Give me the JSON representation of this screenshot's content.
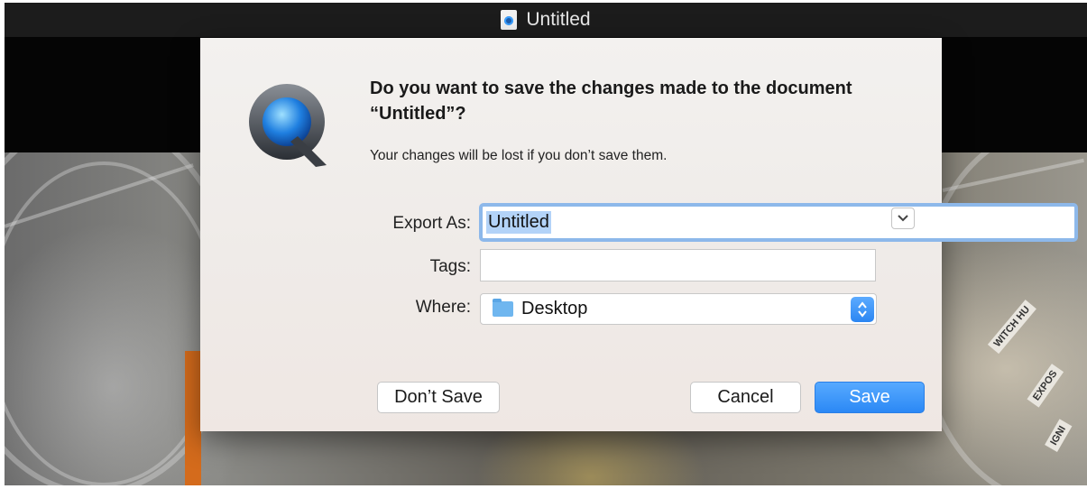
{
  "window": {
    "title": "Untitled",
    "doc_icon": "quicktime-document-icon"
  },
  "background": {
    "tape_labels": [
      "WITCH HU",
      "EXPOS",
      "IGNI"
    ]
  },
  "dialog": {
    "app_icon": "quicktime-q-icon",
    "heading": "Do you want to save the changes made to the document “Untitled”?",
    "message": "Your changes will be lost if you don’t save them.",
    "export_as": {
      "label": "Export As:",
      "value": "Untitled"
    },
    "tags": {
      "label": "Tags:",
      "value": ""
    },
    "where": {
      "label": "Where:",
      "value": "Desktop",
      "icon": "folder-icon"
    },
    "buttons": {
      "dont_save": "Don’t Save",
      "cancel": "Cancel",
      "save": "Save"
    }
  },
  "colors": {
    "accent": "#2b88f5",
    "selection": "#b3d3f8",
    "focus_ring": "#8db8ea"
  }
}
